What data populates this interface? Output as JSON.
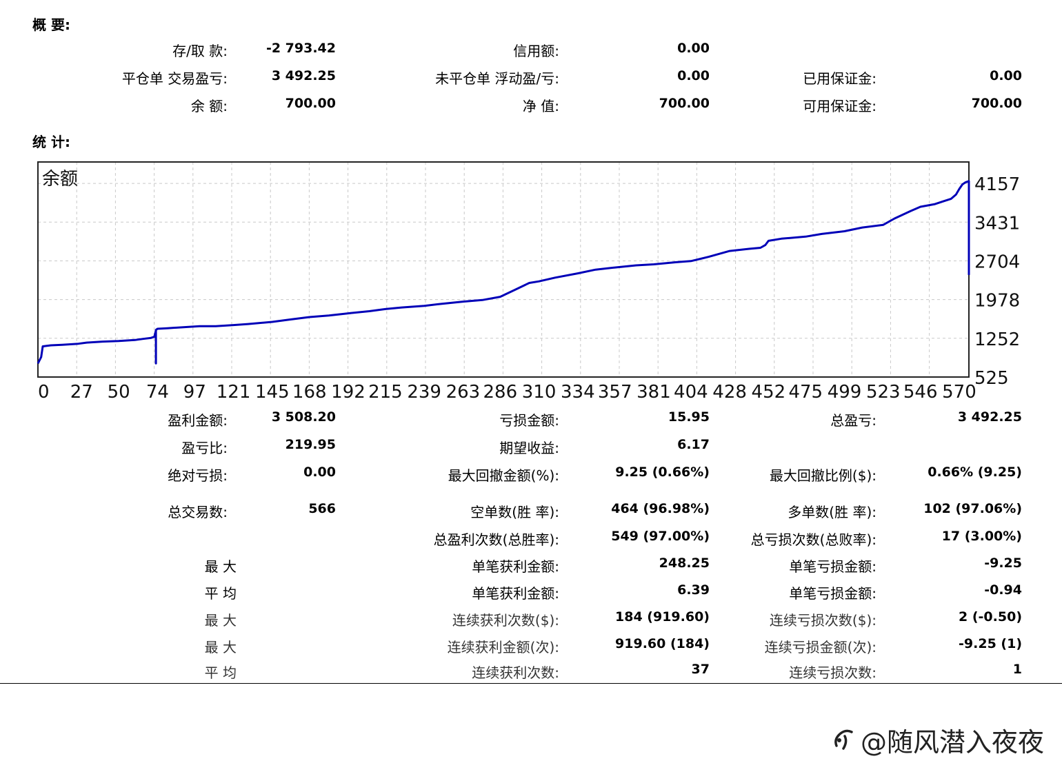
{
  "summary": {
    "title": "概 要:",
    "rows": [
      {
        "y": 0,
        "cells": [
          [
            "存/取 款:",
            "-2 793.42"
          ],
          [
            "信用额:",
            "0.00"
          ],
          [
            "",
            ""
          ]
        ]
      },
      {
        "y": 1,
        "cells": [
          [
            "平仓单 交易盈亏:",
            "3 492.25"
          ],
          [
            "未平仓单 浮动盈/亏:",
            "0.00"
          ],
          [
            "已用保证金:",
            "0.00"
          ]
        ]
      },
      {
        "y": 2,
        "cells": [
          [
            "余 额:",
            "700.00"
          ],
          [
            "净 值:",
            "700.00"
          ],
          [
            "可用保证金:",
            "700.00"
          ]
        ]
      }
    ]
  },
  "stats": {
    "title": "统 计:",
    "rows": [
      {
        "left": "盈利金额:",
        "v1": "3 508.20",
        "mid": "亏损金额:",
        "v2": "15.95",
        "right": "总盈亏:",
        "v3": "3 492.25"
      },
      {
        "left": "盈亏比:",
        "v1": "219.95",
        "mid": "期望收益:",
        "v2": "6.17",
        "right": "",
        "v3": ""
      },
      {
        "left": "绝对亏损:",
        "v1": "0.00",
        "mid": "最大回撤金额(%):",
        "v2": "9.25 (0.66%)",
        "right": "最大回撤比例($):",
        "v3": "0.66% (9.25)"
      },
      {
        "left": "总交易数:",
        "v1": "566",
        "mid": "空单数(胜 率):",
        "v2": "464 (96.98%)",
        "right": "多单数(胜 率):",
        "v3": "102 (97.06%)"
      },
      {
        "left": "",
        "v1": "",
        "mid": "总盈利次数(总胜率):",
        "v2": "549 (97.00%)",
        "right": "总亏损次数(总败率):",
        "v3": "17 (3.00%)"
      },
      {
        "left": "最 大",
        "v1": "",
        "mid": "单笔获利金额:",
        "v2": "248.25",
        "right": "单笔亏损金额:",
        "v3": "-9.25"
      },
      {
        "left": "平 均",
        "v1": "",
        "mid": "单笔获利金额:",
        "v2": "6.39",
        "right": "单笔亏损金额:",
        "v3": "-0.94"
      },
      {
        "left": "最 大",
        "v1": "",
        "mid": "连续获利次数($):",
        "v2": "184 (919.60)",
        "right": "连续亏损次数($):",
        "v3": "2 (-0.50)"
      },
      {
        "left": "最 大",
        "v1": "",
        "mid": "连续获利金额(次):",
        "v2": "919.60 (184)",
        "right": "连续亏损金额(次):",
        "v3": "-9.25 (1)"
      },
      {
        "left": "平 均",
        "v1": "",
        "mid": "连续获利次数:",
        "v2": "37",
        "right": "连续亏损次数:",
        "v3": "1"
      }
    ]
  },
  "watermark": "@随风潜入夜夜",
  "chart_data": {
    "type": "line",
    "title": "余额",
    "x_ticks": [
      0,
      27,
      50,
      74,
      97,
      121,
      145,
      168,
      192,
      215,
      239,
      263,
      286,
      310,
      334,
      357,
      381,
      404,
      428,
      452,
      475,
      499,
      523,
      546,
      570
    ],
    "y_ticks": [
      525,
      1252,
      1978,
      2704,
      3431,
      4157
    ],
    "xlim": [
      0,
      576
    ],
    "ylim": [
      525,
      4560
    ],
    "grid": true,
    "line_color": "#0000b8",
    "series": [
      {
        "x": [
          0,
          2,
          3,
          8,
          15,
          25,
          30,
          40,
          50,
          60,
          65,
          70,
          72,
          73,
          73,
          73,
          74,
          80,
          90,
          100,
          110,
          121,
          130,
          145,
          155,
          168,
          180,
          192,
          205,
          215,
          225,
          239,
          250,
          263,
          275,
          286,
          295,
          304,
          310,
          320,
          334,
          345,
          357,
          370,
          381,
          395,
          404,
          415,
          428,
          440,
          447,
          450,
          452,
          460,
          475,
          485,
          499,
          510,
          523,
          530,
          540,
          546,
          555,
          560,
          565,
          568,
          570,
          572,
          574,
          575,
          576,
          576
        ],
        "y": [
          780,
          900,
          1100,
          1120,
          1130,
          1150,
          1170,
          1190,
          1200,
          1220,
          1240,
          1260,
          1280,
          1400,
          780,
          1410,
          1430,
          1440,
          1460,
          1480,
          1480,
          1500,
          1520,
          1560,
          1600,
          1650,
          1680,
          1720,
          1760,
          1800,
          1830,
          1860,
          1900,
          1940,
          1970,
          2030,
          2160,
          2290,
          2320,
          2390,
          2470,
          2540,
          2580,
          2620,
          2640,
          2680,
          2700,
          2780,
          2890,
          2930,
          2950,
          3000,
          3080,
          3120,
          3160,
          3210,
          3260,
          3330,
          3380,
          3500,
          3640,
          3720,
          3770,
          3820,
          3870,
          3950,
          4050,
          4140,
          4180,
          4190,
          4200,
          2440
        ]
      }
    ]
  }
}
